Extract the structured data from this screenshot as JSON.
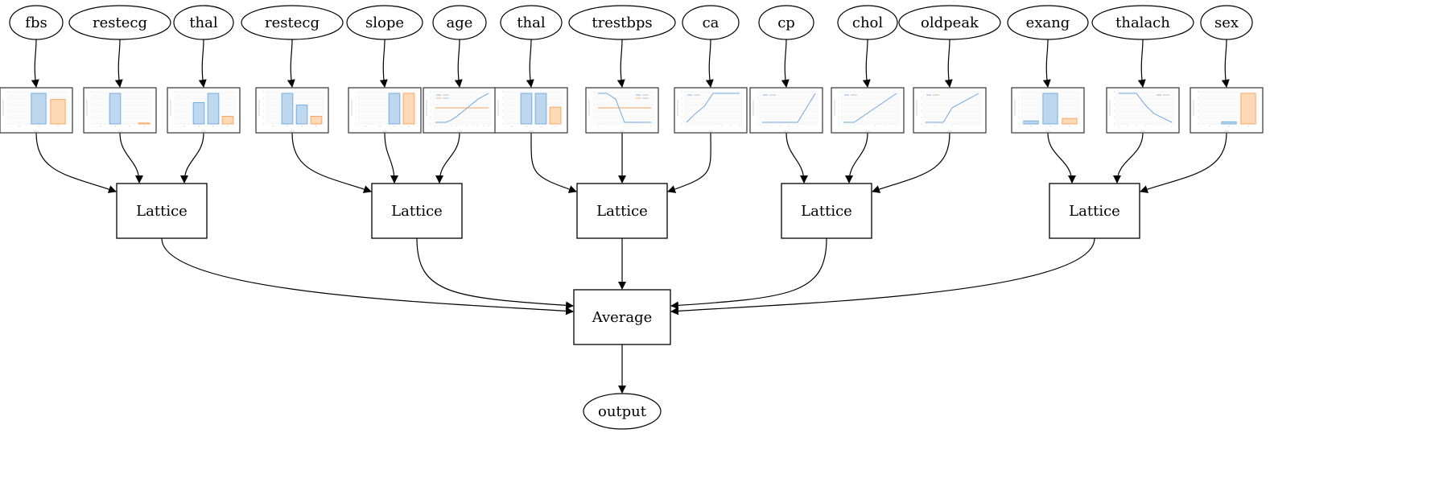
{
  "graph": {
    "features": [
      {
        "id": "f0",
        "label": "fbs",
        "group": 0,
        "plot": {
          "kind": "bar",
          "xlabel": "fbs",
          "categories": [
            "0",
            "1",
            "missing"
          ],
          "values": [
            0,
            1.0,
            0.8
          ],
          "missing_index": 2
        }
      },
      {
        "id": "f1",
        "label": "restecg",
        "group": 0,
        "plot": {
          "kind": "bar",
          "xlabel": "restecg",
          "categories": [
            "0",
            "1",
            "2",
            "missing"
          ],
          "values": [
            0,
            1.0,
            0,
            0.03
          ],
          "missing_index": 3
        }
      },
      {
        "id": "f2",
        "label": "thal",
        "group": 0,
        "plot": {
          "kind": "bar",
          "xlabel": "thal",
          "categories": [
            "normal",
            "fixed",
            "reversible",
            "missing"
          ],
          "values": [
            0,
            0.7,
            1.0,
            0.25
          ],
          "missing_index": 3
        }
      },
      {
        "id": "f3",
        "label": "restecg",
        "group": 1,
        "plot": {
          "kind": "bar",
          "xlabel": "restecg",
          "categories": [
            "0",
            "1",
            "2",
            "missing"
          ],
          "values": [
            0,
            1.0,
            0.62,
            0.25
          ],
          "missing_index": 3
        }
      },
      {
        "id": "f4",
        "label": "slope",
        "group": 1,
        "plot": {
          "kind": "bar",
          "xlabel": "slope",
          "categories": [
            "0",
            "1",
            "2",
            "missing"
          ],
          "values": [
            0,
            0,
            1.0,
            1.0
          ],
          "missing_index": 3
        }
      },
      {
        "id": "f5",
        "label": "age",
        "group": 1,
        "plot": {
          "kind": "line",
          "xlabel": "age",
          "legend": [
            "calibrated",
            "missing"
          ],
          "x": [
            0,
            1,
            2,
            3,
            4,
            5,
            6,
            7,
            8,
            9,
            10
          ],
          "y": [
            0,
            0,
            0,
            0.08,
            0.2,
            0.35,
            0.5,
            0.65,
            0.8,
            0.9,
            1.0
          ],
          "missing_value": 0.5
        }
      },
      {
        "id": "f6",
        "label": "thal",
        "group": 2,
        "plot": {
          "kind": "bar",
          "xlabel": "thal",
          "categories": [
            "normal",
            "fixed",
            "reversible",
            "missing"
          ],
          "values": [
            0,
            1.0,
            1.0,
            0.55
          ],
          "missing_index": 3
        }
      },
      {
        "id": "f7",
        "label": "trestbps",
        "group": 2,
        "plot": {
          "kind": "line",
          "xlabel": "trestbps",
          "legend": [
            "calibrated",
            "missing"
          ],
          "x": [
            0,
            1,
            2,
            3,
            4,
            5,
            6
          ],
          "y": [
            1.0,
            1.0,
            0.8,
            0.0,
            0.0,
            0.0,
            0.0
          ],
          "missing_value": 0.5
        }
      },
      {
        "id": "f8",
        "label": "ca",
        "group": 2,
        "plot": {
          "kind": "line",
          "xlabel": "ca",
          "legend": [
            "calibrated"
          ],
          "x": [
            0,
            1,
            2,
            3,
            4,
            5,
            6
          ],
          "y": [
            0,
            0.3,
            0.55,
            1.0,
            1.0,
            1.0,
            1.0
          ],
          "missing_value": null
        }
      },
      {
        "id": "f9",
        "label": "cp",
        "group": 3,
        "plot": {
          "kind": "line",
          "xlabel": "cp",
          "legend": [
            "calibrated"
          ],
          "x": [
            0,
            1,
            2,
            3,
            4,
            5,
            6
          ],
          "y": [
            0,
            0,
            0,
            0,
            0,
            0.5,
            1.0
          ],
          "missing_value": null
        }
      },
      {
        "id": "f10",
        "label": "chol",
        "group": 3,
        "plot": {
          "kind": "line",
          "xlabel": "chol",
          "legend": [
            "calibrated"
          ],
          "x": [
            0,
            1,
            2,
            3,
            4,
            5
          ],
          "y": [
            0,
            0,
            0.25,
            0.5,
            0.75,
            1.0
          ],
          "missing_value": null
        }
      },
      {
        "id": "f11",
        "label": "oldpeak",
        "group": 3,
        "plot": {
          "kind": "line",
          "xlabel": "oldpeak",
          "legend": [
            "calibrated"
          ],
          "x": [
            0,
            1,
            2,
            3,
            4,
            5,
            6
          ],
          "y": [
            0,
            0,
            0,
            0.5,
            0.67,
            0.83,
            1.0
          ],
          "missing_value": null
        }
      },
      {
        "id": "f12",
        "label": "exang",
        "group": 4,
        "plot": {
          "kind": "bar",
          "xlabel": "exang",
          "categories": [
            "0",
            "1",
            "missing"
          ],
          "values": [
            0.1,
            1.0,
            0.18
          ],
          "missing_index": 2
        }
      },
      {
        "id": "f13",
        "label": "thalach",
        "group": 4,
        "plot": {
          "kind": "line",
          "xlabel": "thalach",
          "legend": [
            "calibrated"
          ],
          "x": [
            0,
            1,
            2,
            3,
            4,
            5,
            6
          ],
          "y": [
            1.0,
            1.0,
            1.0,
            0.6,
            0.3,
            0.15,
            0.0
          ],
          "missing_value": null
        }
      },
      {
        "id": "f14",
        "label": "sex",
        "group": 4,
        "plot": {
          "kind": "bar",
          "xlabel": "sex",
          "categories": [
            "0",
            "1",
            "missing"
          ],
          "values": [
            0,
            0.07,
            1.0
          ],
          "missing_index": 2
        }
      }
    ],
    "lattices": [
      {
        "id": "l0",
        "label": "Lattice"
      },
      {
        "id": "l1",
        "label": "Lattice"
      },
      {
        "id": "l2",
        "label": "Lattice"
      },
      {
        "id": "l3",
        "label": "Lattice"
      },
      {
        "id": "l4",
        "label": "Lattice"
      }
    ],
    "average": {
      "label": "Average"
    },
    "output": {
      "label": "output"
    },
    "colors": {
      "calibrated": "#6fa8dc",
      "calibrated_fill": "#bdd7ee",
      "missing": "#f6a25a",
      "missing_fill": "#fdd9b5",
      "edge": "#000000"
    }
  }
}
